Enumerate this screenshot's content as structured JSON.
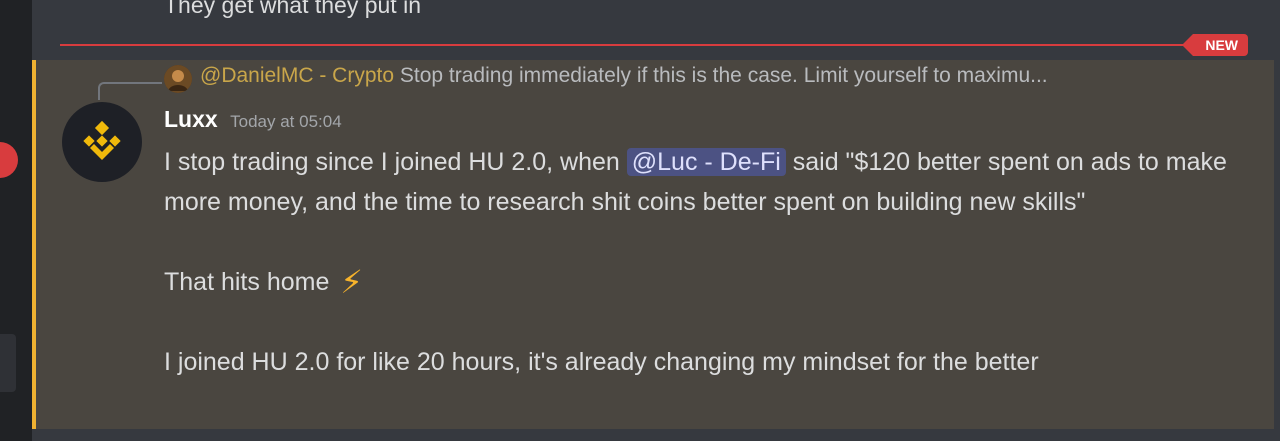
{
  "previous_message": "They get what they put in",
  "new_badge": "NEW",
  "reply": {
    "author": "@DanielMC - Crypto",
    "text": "Stop trading immediately if this is the case. Limit yourself to maximu..."
  },
  "message": {
    "author": "Luxx",
    "timestamp": "Today at 05:04",
    "line1_before": "I stop trading since I joined HU 2.0, when",
    "mention": "@Luc - De-Fi",
    "line1_after": "said \"$120 better spent on ads to make more money, and the time to research shit coins better spent on building new skills\"",
    "line2": "That hits home",
    "line2_emoji": "⚡",
    "line3": "I joined HU 2.0 for like 20 hours, it's already changing my mindset for the better"
  },
  "colors": {
    "accent": "#f0b232",
    "new_red": "#d83c3e",
    "mention_bg": "#4c5283",
    "highlight_bg": "#4a4640"
  }
}
